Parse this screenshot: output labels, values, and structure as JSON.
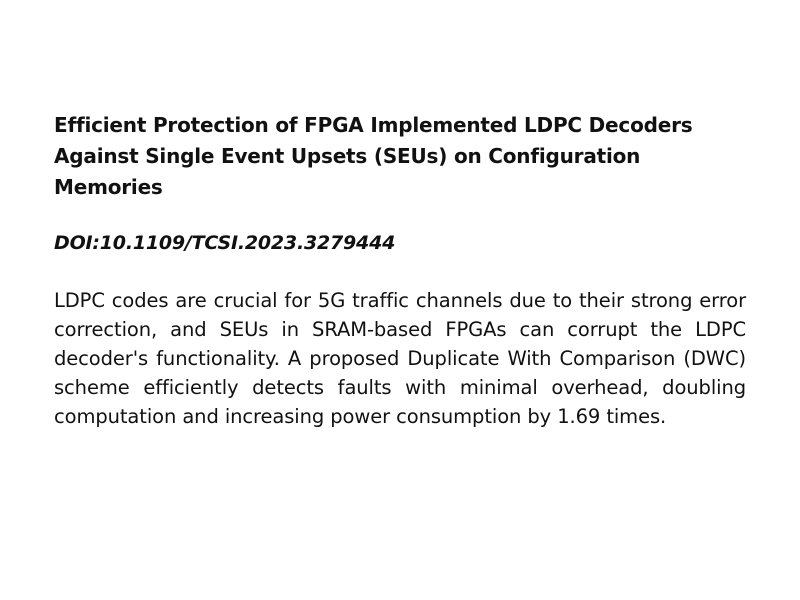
{
  "document": {
    "title": "Efficient Protection of FPGA Implemented LDPC Decoders Against Single Event Upsets (SEUs) on Configuration Memories",
    "doi": "DOI:10.1109/TCSI.2023.3279444",
    "abstract": "LDPC codes are crucial for 5G traffic channels due to their strong error correction, and SEUs in SRAM-based FPGAs can corrupt the LDPC decoder's functionality. A proposed Duplicate With Comparison (DWC) scheme efficiently detects faults with minimal overhead, doubling computation and increasing power consumption by 1.69 times."
  }
}
